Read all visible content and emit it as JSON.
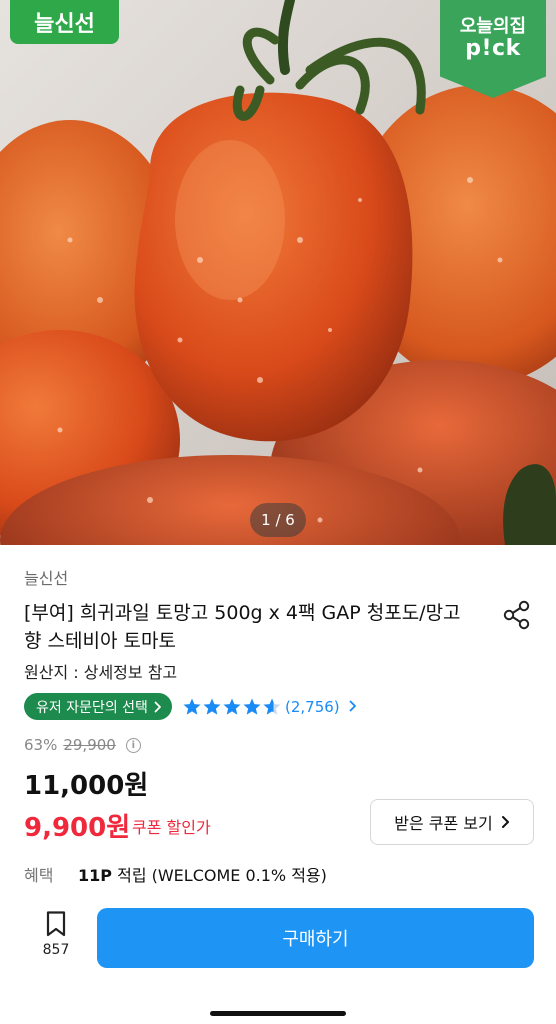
{
  "hero": {
    "brand_badge": "늘신선",
    "pick_badge_line1": "오늘의집",
    "pick_badge_line2": "p!ck",
    "page_indicator": "1 / 6"
  },
  "product": {
    "seller": "늘신선",
    "title": "[부여] 희귀과일 토망고 500g x 4팩 GAP 청포도/망고향 스테비아 토마토",
    "origin": "원산지 : 상세정보 참고",
    "expert_badge": "유저 자문단의 선택",
    "rating": 4.8,
    "review_count": "(2,756)",
    "discount_rate": "63%",
    "original_price": "29,900",
    "price": "11,000원",
    "coupon_price": "9,900원",
    "coupon_label": "쿠폰 할인가",
    "coupon_button": "받은 쿠폰 보기",
    "benefit_label": "혜택",
    "benefit_points": "11P",
    "benefit_desc": "적립 (WELCOME 0.1% 적용)"
  },
  "bottom_bar": {
    "wish_count": "857",
    "buy_label": "구매하기"
  },
  "colors": {
    "brand_green": "#2fa84a",
    "expert_green": "#1d8b4d",
    "link_blue": "#1a8bf5",
    "coupon_red": "#f0283c",
    "buy_blue": "#1e95f5"
  },
  "icons": {
    "share": "share-icon",
    "bookmark": "bookmark-icon",
    "star": "star-icon",
    "info": "info-icon",
    "chevron": "chevron-right-icon"
  }
}
